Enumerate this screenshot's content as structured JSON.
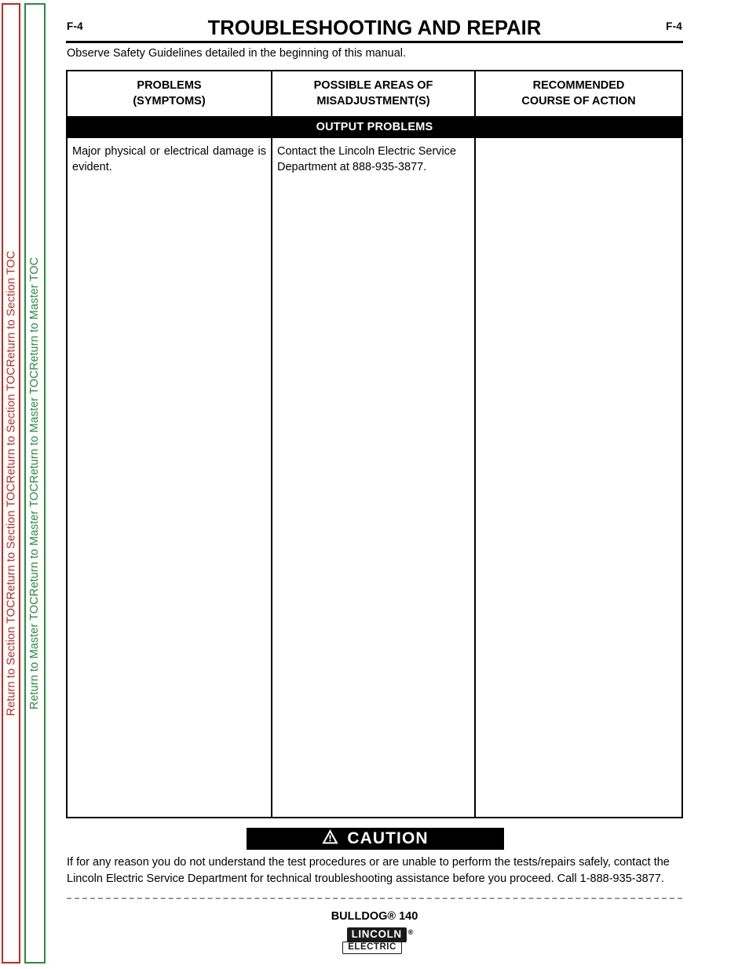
{
  "sidebar": {
    "section_toc": {
      "label": "Return to Section TOC",
      "color": "#bc2b22",
      "repeat": 4
    },
    "master_toc": {
      "label": "Return to Master TOC",
      "color": "#2c8a40",
      "repeat": 4
    }
  },
  "header": {
    "folio_left": "F-4",
    "folio_right": "F-4",
    "title": "TROUBLESHOOTING AND REPAIR"
  },
  "notice": {
    "observe": "Observe Safety Guidelines detailed in the beginning of this manual."
  },
  "table": {
    "columns": [
      "PROBLEMS\n(SYMPTOMS)",
      "POSSIBLE AREAS OF\nMISADJUSTMENT(S)",
      "RECOMMENDED\nCOURSE OF ACTION"
    ],
    "columns_line1": [
      "PROBLEMS",
      "POSSIBLE AREAS OF",
      "RECOMMENDED"
    ],
    "columns_line2": [
      "(SYMPTOMS)",
      "MISADJUSTMENT(S)",
      "COURSE OF ACTION"
    ],
    "section_band": "OUTPUT PROBLEMS",
    "rows": [
      {
        "problem": "Major physical or electrical damage is evident.",
        "misadjustment": "Contact the Lincoln Electric Service Department at 888-935-3877.",
        "action": ""
      }
    ]
  },
  "caution": {
    "icon": "warning-triangle-icon",
    "label": "CAUTION",
    "body": "If for any reason you do not understand the test procedures or are unable to perform the tests/repairs safely, contact the Lincoln Electric Service Department for technical troubleshooting assistance before you proceed. Call 1-888-935-3877."
  },
  "footer": {
    "model": "BULLDOG® 140",
    "logo_primary": "LINCOLN",
    "logo_registered": "®",
    "logo_secondary": "ELECTRIC"
  }
}
